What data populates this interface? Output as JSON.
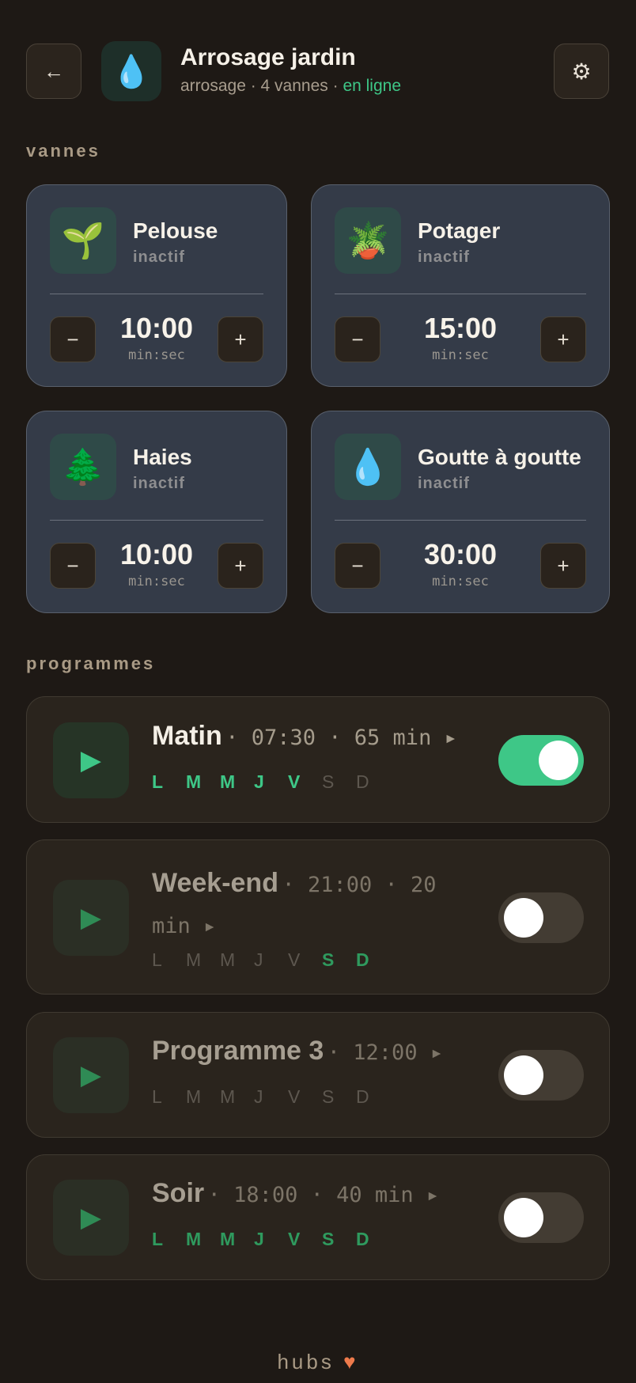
{
  "header": {
    "back_icon": "arrow-left-icon",
    "back_glyph": "←",
    "app_icon_glyph": "💧",
    "title": "Arrosage jardin",
    "subtitle_prefix": "arrosage · 4 vannes ·",
    "status": "en ligne",
    "settings_glyph": "⚙"
  },
  "sections": {
    "valves": "vannes",
    "programs": "programmes"
  },
  "valves": [
    {
      "name": "Pelouse",
      "icon": "🌱",
      "state": "inactif",
      "time": "10:00",
      "unit": "min:sec",
      "minus": "−",
      "plus": "+"
    },
    {
      "name": "Potager",
      "icon": "🪴",
      "state": "inactif",
      "time": "15:00",
      "unit": "min:sec",
      "minus": "−",
      "plus": "+"
    },
    {
      "name": "Haies",
      "icon": "🌲",
      "state": "inactif",
      "time": "10:00",
      "unit": "min:sec",
      "minus": "−",
      "plus": "+"
    },
    {
      "name": "Goutte à goutte",
      "icon": "💧",
      "state": "inactif",
      "time": "30:00",
      "unit": "min:sec",
      "minus": "−",
      "plus": "+"
    }
  ],
  "programs": [
    {
      "name": "Matin",
      "meta": "· 07:30 · 65 min ▸",
      "enabled": true,
      "days": [
        "L",
        "M",
        "M",
        "J",
        "V",
        "S",
        "D"
      ],
      "active_days": [
        true,
        true,
        true,
        true,
        true,
        false,
        false
      ],
      "play": "▶"
    },
    {
      "name": "Week-end",
      "meta": "· 21:00 · 20 min ▸",
      "enabled": false,
      "days": [
        "L",
        "M",
        "M",
        "J",
        "V",
        "S",
        "D"
      ],
      "active_days": [
        false,
        false,
        false,
        false,
        false,
        true,
        true
      ],
      "play": "▶"
    },
    {
      "name": "Programme 3",
      "meta": "· 12:00 ▸",
      "enabled": false,
      "days": [
        "L",
        "M",
        "M",
        "J",
        "V",
        "S",
        "D"
      ],
      "active_days": [
        false,
        false,
        false,
        false,
        false,
        false,
        false
      ],
      "play": "▶"
    },
    {
      "name": "Soir",
      "meta": "· 18:00 · 40 min ▸",
      "enabled": false,
      "days": [
        "L",
        "M",
        "M",
        "J",
        "V",
        "S",
        "D"
      ],
      "active_days": [
        true,
        true,
        true,
        true,
        true,
        true,
        true
      ],
      "play": "▶"
    }
  ],
  "footer": {
    "brand": "hubs",
    "heart": "♥"
  },
  "colors": {
    "accent": "#3ec787",
    "background": "#1e1915",
    "card": "#343b48",
    "heart": "#ee7a4b"
  }
}
